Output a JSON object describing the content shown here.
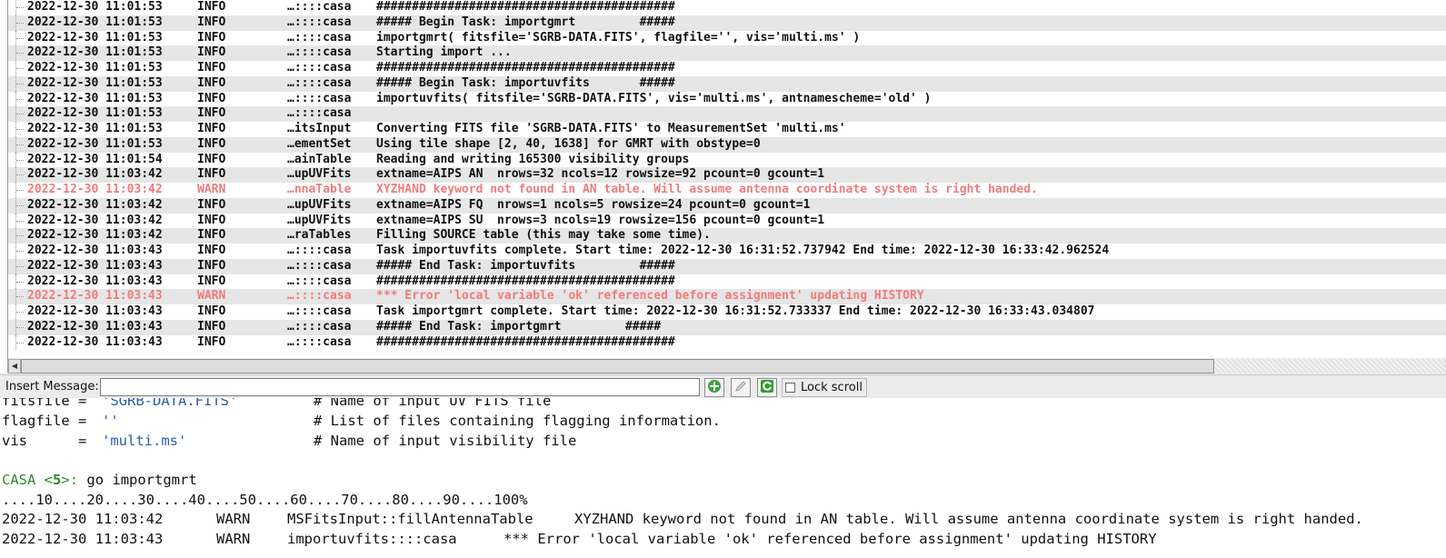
{
  "log": {
    "rows": [
      {
        "datetime": "2022-12-30 11:01:53",
        "level": "INFO",
        "origin": "…::::casa",
        "message": "##########################################"
      },
      {
        "datetime": "2022-12-30 11:01:53",
        "level": "INFO",
        "origin": "…::::casa",
        "message": "##### Begin Task: importgmrt         #####"
      },
      {
        "datetime": "2022-12-30 11:01:53",
        "level": "INFO",
        "origin": "…::::casa",
        "message": "importgmrt( fitsfile='SGRB-DATA.FITS', flagfile='', vis='multi.ms' )"
      },
      {
        "datetime": "2022-12-30 11:01:53",
        "level": "INFO",
        "origin": "…::::casa",
        "message": "Starting import ..."
      },
      {
        "datetime": "2022-12-30 11:01:53",
        "level": "INFO",
        "origin": "…::::casa",
        "message": "##########################################"
      },
      {
        "datetime": "2022-12-30 11:01:53",
        "level": "INFO",
        "origin": "…::::casa",
        "message": "##### Begin Task: importuvfits       #####"
      },
      {
        "datetime": "2022-12-30 11:01:53",
        "level": "INFO",
        "origin": "…::::casa",
        "message": "importuvfits( fitsfile='SGRB-DATA.FITS', vis='multi.ms', antnamescheme='old' )"
      },
      {
        "datetime": "2022-12-30 11:01:53",
        "level": "INFO",
        "origin": "…::::casa",
        "message": ""
      },
      {
        "datetime": "2022-12-30 11:01:53",
        "level": "INFO",
        "origin": "…itsInput",
        "message": "Converting FITS file 'SGRB-DATA.FITS' to MeasurementSet 'multi.ms'"
      },
      {
        "datetime": "2022-12-30 11:01:53",
        "level": "INFO",
        "origin": "…ementSet",
        "message": "Using tile shape [2, 40, 1638] for GMRT with obstype=0"
      },
      {
        "datetime": "2022-12-30 11:01:54",
        "level": "INFO",
        "origin": "…ainTable",
        "message": "Reading and writing 165300 visibility groups"
      },
      {
        "datetime": "2022-12-30 11:03:42",
        "level": "INFO",
        "origin": "…upUVFits",
        "message": "extname=AIPS AN  nrows=32 ncols=12 rowsize=92 pcount=0 gcount=1"
      },
      {
        "datetime": "2022-12-30 11:03:42",
        "level": "WARN",
        "origin": "…nnaTable",
        "message": "XYZHAND keyword not found in AN table. Will assume antenna coordinate system is right handed."
      },
      {
        "datetime": "2022-12-30 11:03:42",
        "level": "INFO",
        "origin": "…upUVFits",
        "message": "extname=AIPS FQ  nrows=1 ncols=5 rowsize=24 pcount=0 gcount=1"
      },
      {
        "datetime": "2022-12-30 11:03:42",
        "level": "INFO",
        "origin": "…upUVFits",
        "message": "extname=AIPS SU  nrows=3 ncols=19 rowsize=156 pcount=0 gcount=1"
      },
      {
        "datetime": "2022-12-30 11:03:42",
        "level": "INFO",
        "origin": "…raTables",
        "message": "Filling SOURCE table (this may take some time)."
      },
      {
        "datetime": "2022-12-30 11:03:43",
        "level": "INFO",
        "origin": "…::::casa",
        "message": "Task importuvfits complete. Start time: 2022-12-30 16:31:52.737942 End time: 2022-12-30 16:33:42.962524"
      },
      {
        "datetime": "2022-12-30 11:03:43",
        "level": "INFO",
        "origin": "…::::casa",
        "message": "##### End Task: importuvfits         #####"
      },
      {
        "datetime": "2022-12-30 11:03:43",
        "level": "INFO",
        "origin": "…::::casa",
        "message": "##########################################"
      },
      {
        "datetime": "2022-12-30 11:03:43",
        "level": "WARN",
        "origin": "…::::casa",
        "message": "*** Error 'local variable 'ok' referenced before assignment' updating HISTORY"
      },
      {
        "datetime": "2022-12-30 11:03:43",
        "level": "INFO",
        "origin": "…::::casa",
        "message": "Task importgmrt complete. Start time: 2022-12-30 16:31:52.733337 End time: 2022-12-30 16:33:43.034807"
      },
      {
        "datetime": "2022-12-30 11:03:43",
        "level": "INFO",
        "origin": "…::::casa",
        "message": "##### End Task: importgmrt         #####"
      },
      {
        "datetime": "2022-12-30 11:03:43",
        "level": "INFO",
        "origin": "…::::casa",
        "message": "##########################################"
      }
    ],
    "colors": {
      "warn": "#f07c7c",
      "info": "#111111",
      "alt_row": "#e6e6e6"
    }
  },
  "toolbar": {
    "insert_label": "Insert Message:",
    "insert_value": "",
    "add_icon": "plus-icon",
    "edit_icon": "pencil-icon",
    "refresh_icon": "refresh-icon",
    "lock_scroll_label": "Lock scroll",
    "lock_scroll_checked": false
  },
  "terminal": {
    "line_fitsfile": {
      "name": "fitsfile =",
      "value": "'SGRB-DATA.FITS'",
      "comment": "# Name of input UV FITS file"
    },
    "line_flagfile": {
      "name": "flagfile =",
      "value": "''",
      "comment": "# List of files containing flagging information."
    },
    "line_vis": {
      "name": "vis      =",
      "value": "'multi.ms'",
      "comment": "# Name of input visibility file"
    },
    "prompt": {
      "label": "CASA",
      "open": "<",
      "number": "5",
      "close": ">:",
      "command": " go importgmrt"
    },
    "progress": "....10....20....30....40....50....60....70....80....90....100%",
    "warn1": {
      "datetime": "2022-12-30 11:03:42",
      "level": "WARN",
      "origin": "MSFitsInput::fillAntennaTable",
      "message": "XYZHAND keyword not found in AN table. Will assume antenna coordinate system is right handed."
    },
    "warn2": {
      "datetime": "2022-12-30 11:03:43",
      "level": "WARN",
      "origin": "importuvfits::::casa",
      "message": "*** Error 'local variable 'ok' referenced before assignment' updating HISTORY"
    }
  }
}
